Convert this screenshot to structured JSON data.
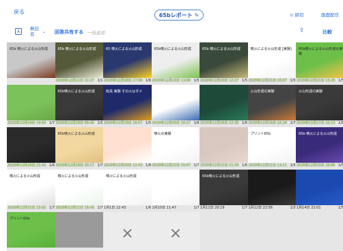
{
  "header": {
    "back_label": "戻る",
    "title": "65bレポート",
    "pencil_icon": "pencil-icon",
    "lock_label": "⊙ 締切",
    "distribute_label": "画面配信"
  },
  "toolbar": {
    "a_icon": "A",
    "unnamed_line1": "無記",
    "unnamed_line2": "名",
    "share_label": "回答共有する",
    "dim_label": "一括返却",
    "export_icon": "share-icon",
    "compare_label": "比較"
  },
  "cells": [
    {
      "date": "",
      "page": "",
      "caption_title": "65b 噴火による火山形成",
      "colors": [
        "#c8c8c8",
        "#7a3a20"
      ]
    },
    {
      "date": "2020年12月11日 22:27",
      "page": "1/1",
      "caption_title": "65b 噴火による火山形成",
      "colors": [
        "#555a3a",
        "#f0eed8"
      ]
    },
    {
      "date": "2020年12月18日 17:04",
      "page": "1/6",
      "caption_title": "65 噴火による火山形成",
      "colors": [
        "#2a3870",
        "#ffd21e"
      ]
    },
    {
      "date": "2020年12月19日 13:00",
      "page": "1/5",
      "caption_title": "65b噴火による火山形成",
      "colors": [
        "#eeeeee",
        "#7bc24a"
      ]
    },
    {
      "date": "2020年12月20日 12:27",
      "page": "1/5",
      "caption_title": "65b 噴火による火山形成",
      "colors": [
        "#3a4a3a",
        "#c8b87a"
      ]
    },
    {
      "date": "2020年12月21日 10:07",
      "page": "1/5",
      "caption_title": "噴火による火山形成 [実験]",
      "colors": [
        "#ffffff",
        "#f2f2f2"
      ]
    },
    {
      "date": "2020年12月21日 13:29",
      "page": "1/5",
      "caption_title": "65b噴火による火山形成の実験",
      "colors": [
        "#6cc04a",
        "#f2c24a"
      ]
    },
    {
      "date": "2020年12月18日 10:03",
      "page": "1/7",
      "caption_title": "",
      "colors": [
        "#7cc25a",
        "#6aaa48"
      ]
    },
    {
      "date": "2020年12月18日 09:30",
      "page": "1/5",
      "caption_title": "65b噴火による火山形成",
      "colors": [
        "#3a3a3a",
        "#2a2a2a"
      ]
    },
    {
      "date": "2020年12月19日 16:57",
      "page": "1/5",
      "caption_title": "班員 実験 その火はダメ",
      "colors": [
        "#1e2a6a",
        "#e0a020"
      ]
    },
    {
      "date": "2020年12月20日 10:27",
      "page": "1/6",
      "caption_title": "",
      "colors": [
        "#ffffff",
        "#3a6ab0"
      ]
    },
    {
      "date": "2020年12月26日 22:35",
      "page": "1/6",
      "caption_title": "",
      "colors": [
        "#1e4a3a",
        "#2a7a5a"
      ]
    },
    {
      "date": "2020年12月16日 22:24",
      "page": "1/7",
      "caption_title": "火山形成の実験",
      "colors": [
        "#444",
        "#c87a3a"
      ]
    },
    {
      "date": "2020年12月17日 10:13",
      "page": "1/6",
      "caption_title": "火山形成の実験",
      "colors": [
        "#3a3a3a",
        "#2a2a2a"
      ]
    },
    {
      "date": "2020年12月16日 21:42",
      "page": "1/6",
      "caption_title": "",
      "colors": [
        "#2a2a2a",
        "#1a1a1a"
      ]
    },
    {
      "date": "2020年12月18日 20:17",
      "page": "1/7",
      "caption_title": "65b噴火による火山形成",
      "colors": [
        "#f2d8a0",
        "#e0c080"
      ]
    },
    {
      "date": "2020年12月20日 12:43",
      "page": "1/8",
      "caption_title": "",
      "colors": [
        "#ffe0d0",
        "#ffffff"
      ]
    },
    {
      "date": "2020年12月21日 10:07",
      "page": "1/7",
      "caption_title": "噴火の実験",
      "colors": [
        "#ffffff",
        "#f2f2f2"
      ]
    },
    {
      "date": "2020年12月22日 21:34",
      "page": "1/6",
      "caption_title": "",
      "colors": [
        "#d8c8c0",
        "#e8d8d0"
      ]
    },
    {
      "date": "2020年12月21日 13:11",
      "page": "1/5",
      "caption_title": "プリント65b",
      "colors": [
        "#ffffff",
        "#f2f2f2"
      ]
    },
    {
      "date": "2020年12月23日 10:05",
      "page": "1/5",
      "caption_title": "65b 噴火による火山形成",
      "colors": [
        "#3a2a7a",
        "#6a4ab0"
      ]
    },
    {
      "date": "2020年12月21日 15:02",
      "page": "1/7",
      "caption_title": "噴火による火山形成",
      "colors": [
        "#ffffff",
        "#e0e0e0"
      ]
    },
    {
      "date": "2020年12月21日 16:45",
      "page": "1/7",
      "caption_title": "噴火による火山形成",
      "colors": [
        "#ffffff",
        "#e8f4e8"
      ]
    },
    {
      "date": "1月1日 22:43",
      "page": "1/6",
      "caption_title": "噴火による火山形成",
      "colors": [
        "#ffffff",
        "#f2f2f2"
      ]
    },
    {
      "date": "1月10日 11:47",
      "page": "1/7",
      "caption_title": "",
      "colors": [
        "#ffffff",
        "#f2f2f2"
      ]
    },
    {
      "date": "1月11日 20:19",
      "page": "1/7",
      "caption_title": "65b噴火による火山形成",
      "colors": [
        "#3a3a3a",
        "#2a2a2a"
      ]
    },
    {
      "date": "1月12日 22:56",
      "page": "1/3",
      "caption_title": "",
      "colors": [
        "#1a1a1a",
        "#3a3a3a"
      ]
    },
    {
      "date": "1月14日 22:01",
      "page": "1/5",
      "caption_title": "",
      "colors": [
        "#1a4ab0",
        "#2a5ac8"
      ]
    },
    {
      "date": "",
      "page": "",
      "caption_title": "プリント65b",
      "colors": [
        "#6cc04a",
        "#5ab038"
      ]
    },
    {
      "date": "",
      "page": "",
      "caption_title": "",
      "colors": [
        "#9a9a9a",
        "#9a9a9a"
      ]
    },
    {
      "date": "",
      "page": "",
      "caption_title": "×",
      "colors": [
        "#ececec",
        "#ececec"
      ]
    },
    {
      "date": "",
      "page": "",
      "caption_title": "×",
      "colors": [
        "#ececec",
        "#ececec"
      ]
    }
  ]
}
